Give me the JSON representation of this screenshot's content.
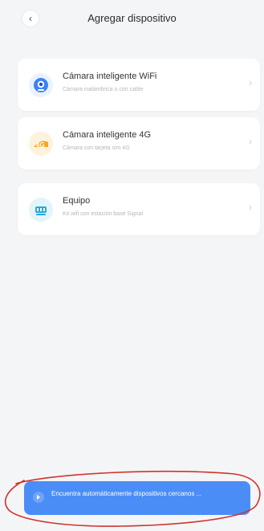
{
  "header": {
    "title": "Agregar dispositivo",
    "back_icon": "chevron-left-icon"
  },
  "devices": [
    {
      "title": "Cámara inteligente WiFi",
      "subtitle": "Cámara inalámbrica o con cable",
      "icon": "wifi-camera-icon",
      "icon_color": "#3b82f6"
    },
    {
      "title": "Cámara inteligente 4G",
      "subtitle": "Cámara con tarjeta sim 4G",
      "icon": "4g-camera-icon",
      "icon_color": "#f5a623"
    },
    {
      "title": "Equipo",
      "subtitle": "Kit wifi con estación base Signal",
      "icon": "base-station-icon",
      "icon_color": "#29a8e0"
    }
  ],
  "footer": {
    "auto_find_label": "Encuentra automáticamente dispositivos cercanos ...",
    "button_color": "#4b8df7",
    "annotation_color": "#d0342c"
  }
}
